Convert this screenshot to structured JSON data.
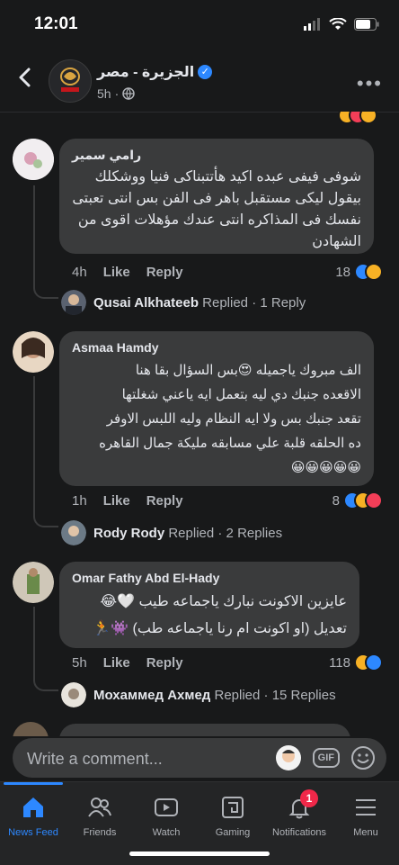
{
  "status": {
    "time": "12:01"
  },
  "header": {
    "page_name": "الجزيرة - مصر",
    "time": "5h",
    "privacy_icon": "globe-icon"
  },
  "comments": [
    {
      "author": "رامي سمير",
      "text": "شوفى فيفى عبده اكيد هأتتبناكى فنيا ووشكلك بيقول ليكى مستقبل باهر فى الفن بس انتى تعبتى نفسك فى المذاكره انتى عندك مؤهلات اقوى من الشهادن",
      "time": "4h",
      "like": "Like",
      "reply": "Reply",
      "count": "18",
      "reply_author": "Qusai Alkhateeb",
      "replied": "Replied",
      "replies": "· 1 Reply"
    },
    {
      "author": "Asmaa Hamdy",
      "text": "الف مبروك ياجميله 😍بس السؤال بقا هنا\nالاقعده جنبك دي ليه بتعمل ايه ياعني شغلتها\nتقعد جنبك بس ولا ايه النظام وليه اللبس الاوفر\nده الحلقه قلبة علي مسابقه مليكة جمال القاهره\n😀😀😀😀😀",
      "time": "1h",
      "like": "Like",
      "reply": "Reply",
      "count": "8",
      "reply_author": "Rody Rody",
      "replied": "Replied",
      "replies": "· 2 Replies"
    },
    {
      "author": "Omar Fathy Abd El-Hady",
      "text": "عايزين الاكونت نبارك ياجماعه طيب 🤍😂\nتعديل (او اكونت ام رنا ياجماعه طب) 👾🏃",
      "time": "5h",
      "like": "Like",
      "reply": "Reply",
      "count": "118",
      "reply_author": "Мохаммед Ахмед",
      "replied": "Replied",
      "replies": "· 15 Replies"
    }
  ],
  "composer": {
    "placeholder": "Write a comment...",
    "gif": "GIF"
  },
  "tabs": [
    {
      "label": "News Feed",
      "icon": "home-icon"
    },
    {
      "label": "Friends",
      "icon": "friends-icon"
    },
    {
      "label": "Watch",
      "icon": "watch-icon"
    },
    {
      "label": "Gaming",
      "icon": "gaming-icon"
    },
    {
      "label": "Notifications",
      "icon": "bell-icon",
      "badge": "1"
    },
    {
      "label": "Menu",
      "icon": "menu-icon"
    }
  ],
  "colors": {
    "accent": "#2d88ff",
    "bubble": "#3a3b3c",
    "background": "#18191a"
  }
}
